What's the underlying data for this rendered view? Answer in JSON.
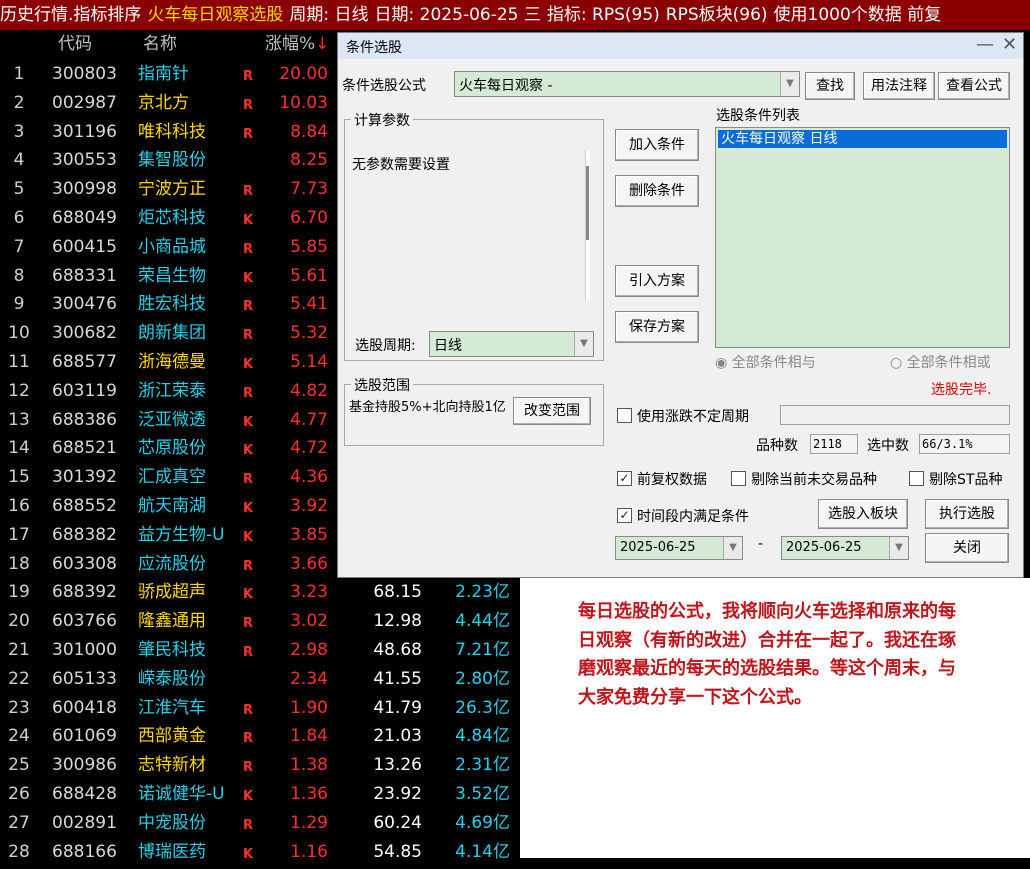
{
  "topbar": {
    "prefix": "历史行情.指标排序",
    "formula": "火车每日观察选股",
    "period": "周期: 日线",
    "date": "日期: 2025-06-25 三",
    "indicator": "指标: RPS(95)",
    "block": "RPS板块(96)",
    "tail": "使用1000个数据 前复"
  },
  "header": {
    "code": "代码",
    "name": "名称",
    "pct": "涨幅%",
    "sort_arrow": "↓"
  },
  "rows": [
    {
      "idx": "1",
      "code": "300803",
      "name": "指南针",
      "color": "cyan",
      "tag": "R",
      "pct": "20.00",
      "price": "",
      "amt": ""
    },
    {
      "idx": "2",
      "code": "002987",
      "name": "京北方",
      "color": "yellow",
      "tag": "R",
      "pct": "10.03",
      "price": "",
      "amt": ""
    },
    {
      "idx": "3",
      "code": "301196",
      "name": "唯科科技",
      "color": "yellow",
      "tag": "R",
      "pct": "8.84",
      "price": "",
      "amt": ""
    },
    {
      "idx": "4",
      "code": "300553",
      "name": "集智股份",
      "color": "cyan",
      "tag": "",
      "pct": "8.25",
      "price": "",
      "amt": ""
    },
    {
      "idx": "5",
      "code": "300998",
      "name": "宁波方正",
      "color": "yellow",
      "tag": "R",
      "pct": "7.73",
      "price": "",
      "amt": ""
    },
    {
      "idx": "6",
      "code": "688049",
      "name": "炬芯科技",
      "color": "cyan",
      "tag": "K",
      "pct": "6.70",
      "price": "",
      "amt": ""
    },
    {
      "idx": "7",
      "code": "600415",
      "name": "小商品城",
      "color": "cyan",
      "tag": "R",
      "pct": "5.85",
      "price": "",
      "amt": ""
    },
    {
      "idx": "8",
      "code": "688331",
      "name": "荣昌生物",
      "color": "cyan",
      "tag": "K",
      "pct": "5.61",
      "price": "",
      "amt": ""
    },
    {
      "idx": "9",
      "code": "300476",
      "name": "胜宏科技",
      "color": "cyan",
      "tag": "R",
      "pct": "5.41",
      "price": "",
      "amt": ""
    },
    {
      "idx": "10",
      "code": "300682",
      "name": "朗新集团",
      "color": "cyan",
      "tag": "R",
      "pct": "5.32",
      "price": "",
      "amt": ""
    },
    {
      "idx": "11",
      "code": "688577",
      "name": "浙海德曼",
      "color": "yellow",
      "tag": "K",
      "pct": "5.14",
      "price": "",
      "amt": ""
    },
    {
      "idx": "12",
      "code": "603119",
      "name": "浙江荣泰",
      "color": "cyan",
      "tag": "R",
      "pct": "4.82",
      "price": "",
      "amt": ""
    },
    {
      "idx": "13",
      "code": "688386",
      "name": "泛亚微透",
      "color": "cyan",
      "tag": "K",
      "pct": "4.77",
      "price": "",
      "amt": ""
    },
    {
      "idx": "14",
      "code": "688521",
      "name": "芯原股份",
      "color": "cyan",
      "tag": "K",
      "pct": "4.72",
      "price": "",
      "amt": ""
    },
    {
      "idx": "15",
      "code": "301392",
      "name": "汇成真空",
      "color": "cyan",
      "tag": "R",
      "pct": "4.36",
      "price": "",
      "amt": ""
    },
    {
      "idx": "16",
      "code": "688552",
      "name": "航天南湖",
      "color": "cyan",
      "tag": "K",
      "pct": "3.92",
      "price": "",
      "amt": ""
    },
    {
      "idx": "17",
      "code": "688382",
      "name": "益方生物-U",
      "color": "cyan",
      "tag": "K",
      "pct": "3.85",
      "price": "",
      "amt": ""
    },
    {
      "idx": "18",
      "code": "603308",
      "name": "应流股份",
      "color": "cyan",
      "tag": "R",
      "pct": "3.66",
      "price": "",
      "amt": ""
    },
    {
      "idx": "19",
      "code": "688392",
      "name": "骄成超声",
      "color": "yellow",
      "tag": "K",
      "pct": "3.23",
      "price": "68.15",
      "amt": "2.23亿"
    },
    {
      "idx": "20",
      "code": "603766",
      "name": "隆鑫通用",
      "color": "yellow",
      "tag": "R",
      "pct": "3.02",
      "price": "12.98",
      "amt": "4.44亿"
    },
    {
      "idx": "21",
      "code": "301000",
      "name": "肇民科技",
      "color": "cyan",
      "tag": "R",
      "pct": "2.98",
      "price": "48.68",
      "amt": "7.21亿"
    },
    {
      "idx": "22",
      "code": "605133",
      "name": "嵘泰股份",
      "color": "cyan",
      "tag": "",
      "pct": "2.34",
      "price": "41.55",
      "amt": "2.80亿"
    },
    {
      "idx": "23",
      "code": "600418",
      "name": "江淮汽车",
      "color": "cyan",
      "tag": "R",
      "pct": "1.90",
      "price": "41.79",
      "amt": "26.3亿"
    },
    {
      "idx": "24",
      "code": "601069",
      "name": "西部黄金",
      "color": "yellow",
      "tag": "R",
      "pct": "1.84",
      "price": "21.03",
      "amt": "4.84亿"
    },
    {
      "idx": "25",
      "code": "300986",
      "name": "志特新材",
      "color": "yellow",
      "tag": "R",
      "pct": "1.38",
      "price": "13.26",
      "amt": "2.31亿"
    },
    {
      "idx": "26",
      "code": "688428",
      "name": "诺诚健华-U",
      "color": "cyan",
      "tag": "K",
      "pct": "1.36",
      "price": "23.92",
      "amt": "3.52亿"
    },
    {
      "idx": "27",
      "code": "002891",
      "name": "中宠股份",
      "color": "cyan",
      "tag": "R",
      "pct": "1.29",
      "price": "60.24",
      "amt": "4.69亿"
    },
    {
      "idx": "28",
      "code": "688166",
      "name": "博瑞医药",
      "color": "cyan",
      "tag": "K",
      "pct": "1.16",
      "price": "54.85",
      "amt": "4.14亿"
    }
  ],
  "dialog": {
    "title": "条件选股",
    "min_icon": "—",
    "close_icon": "✕",
    "formula_label": "条件选股公式",
    "formula_value": "火车每日观察  -",
    "find": "查找",
    "usage": "用法注释",
    "view": "查看公式",
    "params_group": "计算参数",
    "params_text": "无参数需要设置",
    "period_label": "选股周期:",
    "period_value": "日线",
    "add": "加入条件",
    "delete": "删除条件",
    "import": "引入方案",
    "save": "保存方案",
    "list_title": "选股条件列表",
    "list_items": [
      "火车每日观察  日线"
    ],
    "radio_and": "全部条件相与",
    "radio_or": "全部条件相或",
    "done": "选股完毕.",
    "range_group": "选股范围",
    "range_text": "基金持股5%+北向持股1亿",
    "change_range": "改变范围",
    "uncertain_period": "使用涨跌不定周期",
    "count_label": "品种数",
    "count_value": "2118",
    "selected_label": "选中数",
    "selected_value": "66/3.1%",
    "adj": "前复权数据",
    "exclude_untraded": "剔除当前未交易品种",
    "exclude_st": "剔除ST品种",
    "in_period": "时间段内满足条件",
    "to_block": "选股入板块",
    "execute": "执行选股",
    "date_from": "2025-06-25",
    "dash": "-",
    "date_to": "2025-06-25",
    "close": "关闭"
  },
  "note": "每日选股的公式，我将顺向火车选择和原来的每日观察（有新的改进）合并在一起了。我还在琢磨观察最近的每天的选股结果。等这个周末，与大家免费分享一下这个公式。"
}
